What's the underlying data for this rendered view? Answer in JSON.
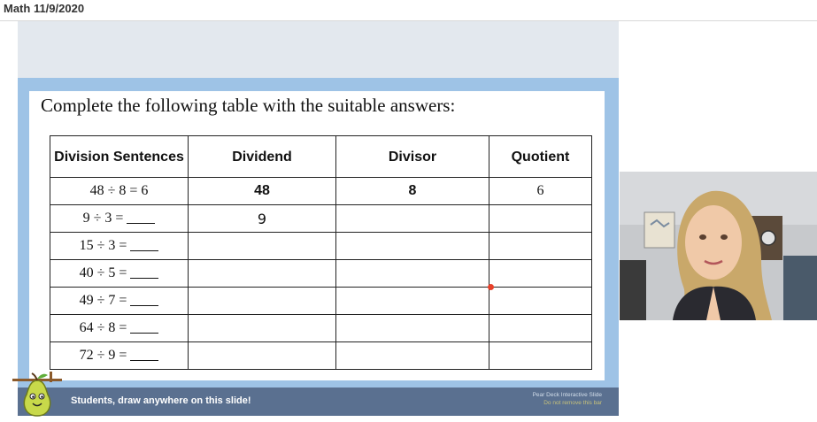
{
  "window": {
    "title": "Math 11/9/2020"
  },
  "slide": {
    "heading": "Complete the following table with the suitable answers:",
    "table": {
      "headers": [
        "Division Sentences",
        "Dividend",
        "Divisor",
        "Quotient"
      ],
      "rows": [
        {
          "sentence": "48 ÷ 8 = 6",
          "dividend": "48",
          "divisor": "8",
          "quotient": "6"
        },
        {
          "sentence": "9 ÷ 3 =",
          "dividend": "9",
          "divisor": "",
          "quotient": ""
        },
        {
          "sentence": "15 ÷ 3 =",
          "dividend": "",
          "divisor": "",
          "quotient": ""
        },
        {
          "sentence": "40 ÷ 5 =",
          "dividend": "",
          "divisor": "",
          "quotient": ""
        },
        {
          "sentence": "49 ÷ 7 =",
          "dividend": "",
          "divisor": "",
          "quotient": ""
        },
        {
          "sentence": "64 ÷ 8 =",
          "dividend": "",
          "divisor": "",
          "quotient": ""
        },
        {
          "sentence": "72 ÷ 9 =",
          "dividend": "",
          "divisor": "",
          "quotient": ""
        }
      ]
    }
  },
  "bottom_bar": {
    "message": "Students, draw anywhere on this slide!",
    "label": "Pear Deck Interactive Slide",
    "note": "Do not remove this bar"
  },
  "icons": {
    "logo": "pear-deck-logo-icon",
    "webcam": "teacher-webcam-feed"
  },
  "colors": {
    "slide_frame": "#9ec3e6",
    "bottom_bar": "#5a7090",
    "handwriting": "#7b3fe0",
    "ink_dot": "#e8402a"
  }
}
